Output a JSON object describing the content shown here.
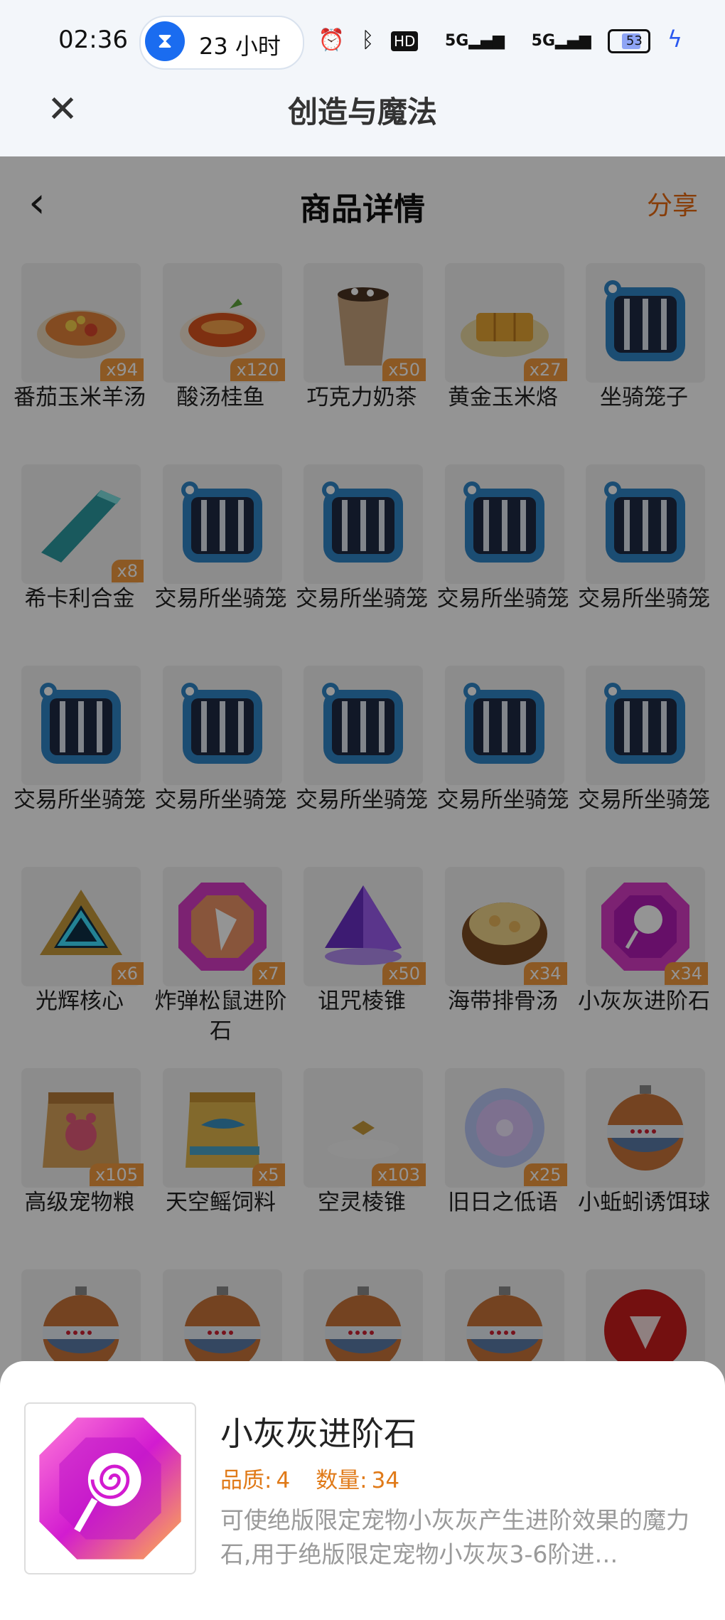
{
  "status_bar": {
    "time": "02:36",
    "timer_text": "23 小时",
    "hd_label": "HD",
    "signal1": "5G",
    "signal2": "5G",
    "battery": "53",
    "battery_level_percent": 53
  },
  "app_bar": {
    "title": "创造与魔法"
  },
  "nav": {
    "title": "商品详情",
    "share_label": "分享"
  },
  "items": [
    {
      "name": "番茄玉米羊汤",
      "qty": "x94",
      "icon": "tomato-corn-soup-icon"
    },
    {
      "name": "酸汤桂鱼",
      "qty": "x120",
      "icon": "sour-fish-soup-icon"
    },
    {
      "name": "巧克力奶茶",
      "qty": "x50",
      "icon": "chocolate-milk-tea-icon"
    },
    {
      "name": "黄金玉米烙",
      "qty": "x27",
      "icon": "golden-corn-cake-icon"
    },
    {
      "name": "坐骑笼子",
      "qty": "",
      "icon": "mount-cage-icon"
    },
    {
      "name": "希卡利合金",
      "qty": "x8",
      "icon": "alloy-bar-icon"
    },
    {
      "name": "交易所坐骑笼",
      "qty": "",
      "icon": "mount-cage-icon"
    },
    {
      "name": "交易所坐骑笼",
      "qty": "",
      "icon": "mount-cage-icon"
    },
    {
      "name": "交易所坐骑笼",
      "qty": "",
      "icon": "mount-cage-icon"
    },
    {
      "name": "交易所坐骑笼",
      "qty": "",
      "icon": "mount-cage-icon"
    },
    {
      "name": "交易所坐骑笼",
      "qty": "",
      "icon": "mount-cage-icon"
    },
    {
      "name": "交易所坐骑笼",
      "qty": "",
      "icon": "mount-cage-icon"
    },
    {
      "name": "交易所坐骑笼",
      "qty": "",
      "icon": "mount-cage-icon"
    },
    {
      "name": "交易所坐骑笼",
      "qty": "",
      "icon": "mount-cage-icon"
    },
    {
      "name": "交易所坐骑笼",
      "qty": "",
      "icon": "mount-cage-icon"
    },
    {
      "name": "光辉核心",
      "qty": "x6",
      "icon": "radiant-core-icon"
    },
    {
      "name": "炸弹松鼠进阶石",
      "qty": "x7",
      "icon": "gem-stone-icon"
    },
    {
      "name": "诅咒棱锥",
      "qty": "x50",
      "icon": "cursed-pyramid-icon"
    },
    {
      "name": "海带排骨汤",
      "qty": "x34",
      "icon": "kelp-rib-soup-icon"
    },
    {
      "name": "小灰灰进阶石",
      "qty": "x34",
      "icon": "lollipop-gem-icon"
    },
    {
      "name": "高级宠物粮",
      "qty": "x105",
      "icon": "pet-food-bag-icon"
    },
    {
      "name": "天空鳐饲料",
      "qty": "x5",
      "icon": "feed-bag-icon"
    },
    {
      "name": "空灵棱锥",
      "qty": "x103",
      "icon": "ethereal-pyramid-icon"
    },
    {
      "name": "旧日之低语",
      "qty": "x25",
      "icon": "whisper-orb-icon"
    },
    {
      "name": "小蚯蚓诱饵球",
      "qty": "",
      "icon": "bait-ball-icon"
    },
    {
      "name": "",
      "qty": "",
      "icon": "bait-ball-icon"
    },
    {
      "name": "",
      "qty": "",
      "icon": "bait-ball-icon"
    },
    {
      "name": "",
      "qty": "",
      "icon": "bait-ball-icon"
    },
    {
      "name": "",
      "qty": "",
      "icon": "bait-ball-icon"
    },
    {
      "name": "",
      "qty": "",
      "icon": "red-seal-icon"
    }
  ],
  "sheet": {
    "title": "小灰灰进阶石",
    "quality_label": "品质:",
    "quality_value": "4",
    "count_label": "数量:",
    "count_value": "34",
    "description": "可使绝版限定宠物小灰灰产生进阶效果的魔力石,用于绝版限定宠物小灰灰3-6阶进…"
  },
  "colors": {
    "accent": "#e86a10",
    "qty_badge": "#f19a3e",
    "timer_blue": "#1a6cf0"
  }
}
